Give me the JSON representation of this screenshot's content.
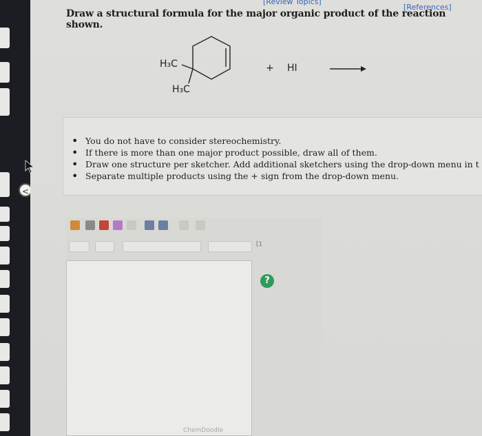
{
  "header": {
    "review_topics": "[Review Topics]",
    "references": "[References]"
  },
  "question": {
    "text": "Draw a structural formula for the major organic product of the reaction shown."
  },
  "reaction": {
    "substituent_top": "H₃C",
    "substituent_bottom": "H₃C",
    "plus": "+",
    "reagent": "HI"
  },
  "hints": [
    "You do not have to consider stereochemistry.",
    "If there is more than one major product possible, draw all of them.",
    "Draw one structure per sketcher. Add additional sketchers using the drop-down menu in t",
    "Separate multiple products using the + sign from the drop-down menu."
  ],
  "sketcher": {
    "help_label": "?",
    "footer": "ChemDoodle",
    "element_label": "[1"
  },
  "sidebar": {
    "collapse_label": "<"
  },
  "colors": {
    "link": "#3a63c0",
    "help": "#2f9b5a",
    "bezel": "#1b1d22"
  }
}
